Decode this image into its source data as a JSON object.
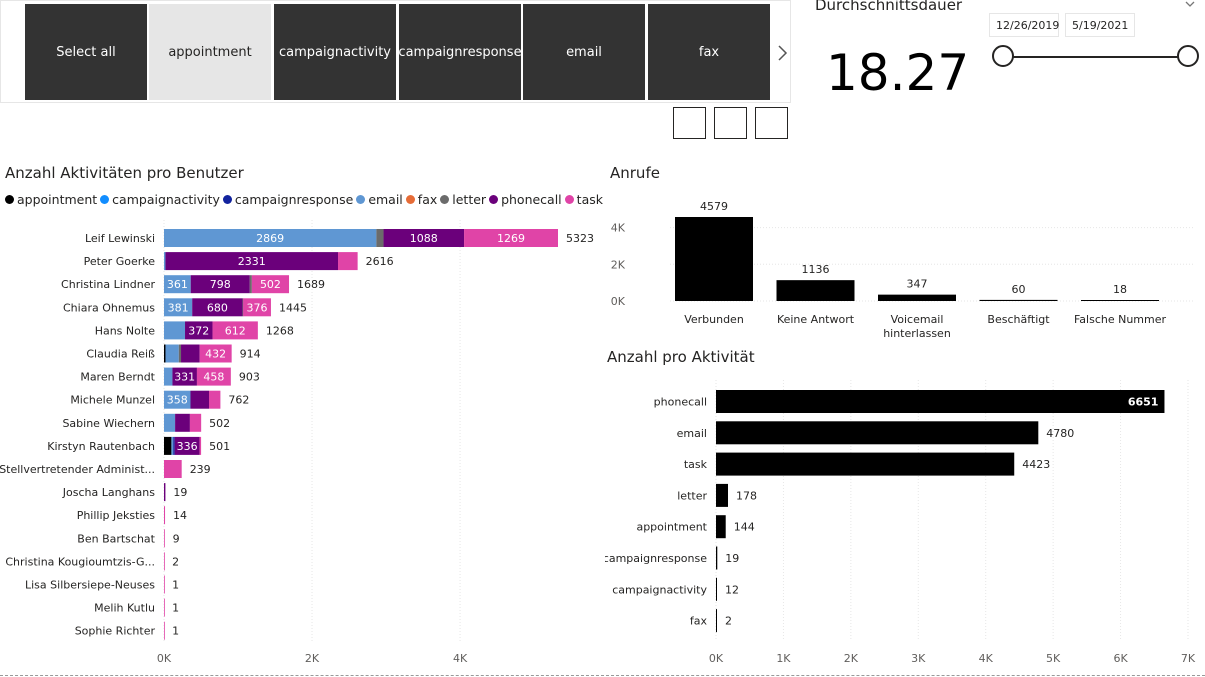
{
  "slicer": {
    "tiles": [
      {
        "label": "Select all",
        "selected": false
      },
      {
        "label": "appointment",
        "selected": true
      },
      {
        "label": "campaignactivity",
        "selected": false
      },
      {
        "label": "campaignresponse",
        "selected": false
      },
      {
        "label": "email",
        "selected": false
      },
      {
        "label": "fax",
        "selected": false
      }
    ],
    "next_icon": "chevron-right-icon"
  },
  "card": {
    "title": "Durchschnittsdauer",
    "value": "18.27"
  },
  "date_slicer": {
    "start": "12/26/2019",
    "end": "5/19/2021",
    "chevron_icon": "chevron-down-icon"
  },
  "colors": {
    "appointment": "#000000",
    "campaignactivity": "#118DFF",
    "campaignresponse": "#12239E",
    "email": "#5F97D3",
    "fax": "#E66C37",
    "letter": "#6B6B6B",
    "phonecall": "#6B007B",
    "task": "#E044A7",
    "bar": "#000000"
  },
  "chart_data": [
    {
      "type": "bar",
      "orientation": "horizontal",
      "stacked": true,
      "title": "Anzahl Aktivitäten pro Benutzer",
      "legend_position": "top-left",
      "series_names": [
        "appointment",
        "campaignactivity",
        "campaignresponse",
        "email",
        "fax",
        "letter",
        "phonecall",
        "task"
      ],
      "xlim": [
        0,
        5323
      ],
      "xticks": [
        "0K",
        "2K",
        "4K"
      ],
      "rows": [
        {
          "name": "Leif Lewinski",
          "total": 5323,
          "segments": [
            {
              "s": "email",
              "v": 2869,
              "label": "2869"
            },
            {
              "s": "letter",
              "v": 97
            },
            {
              "s": "phonecall",
              "v": 1088,
              "label": "1088"
            },
            {
              "s": "task",
              "v": 1269,
              "label": "1269"
            }
          ]
        },
        {
          "name": "Peter Goerke",
          "total": 2616,
          "segments": [
            {
              "s": "email",
              "v": 20
            },
            {
              "s": "phonecall",
              "v": 2331,
              "label": "2331"
            },
            {
              "s": "task",
              "v": 265
            }
          ]
        },
        {
          "name": "Christina Lindner",
          "total": 1689,
          "segments": [
            {
              "s": "email",
              "v": 361,
              "label": "361"
            },
            {
              "s": "phonecall",
              "v": 798,
              "label": "798"
            },
            {
              "s": "letter",
              "v": 28
            },
            {
              "s": "task",
              "v": 502,
              "label": "502"
            }
          ]
        },
        {
          "name": "Chiara Ohnemus",
          "total": 1445,
          "segments": [
            {
              "s": "email",
              "v": 381,
              "label": "381"
            },
            {
              "s": "phonecall",
              "v": 680,
              "label": "680"
            },
            {
              "s": "letter",
              "v": 8
            },
            {
              "s": "task",
              "v": 376,
              "label": "376"
            }
          ]
        },
        {
          "name": "Hans Nolte",
          "total": 1268,
          "segments": [
            {
              "s": "email",
              "v": 284
            },
            {
              "s": "phonecall",
              "v": 372,
              "label": "372"
            },
            {
              "s": "task",
              "v": 612,
              "label": "612"
            }
          ]
        },
        {
          "name": "Claudia Reiß",
          "total": 914,
          "segments": [
            {
              "s": "appointment",
              "v": 20
            },
            {
              "s": "email",
              "v": 180
            },
            {
              "s": "letter",
              "v": 30
            },
            {
              "s": "phonecall",
              "v": 252
            },
            {
              "s": "task",
              "v": 432,
              "label": "432"
            }
          ]
        },
        {
          "name": "Maren Berndt",
          "total": 903,
          "segments": [
            {
              "s": "email",
              "v": 114
            },
            {
              "s": "phonecall",
              "v": 331,
              "label": "331"
            },
            {
              "s": "task",
              "v": 458,
              "label": "458"
            }
          ]
        },
        {
          "name": "Michele Munzel",
          "total": 762,
          "segments": [
            {
              "s": "email",
              "v": 358,
              "label": "358"
            },
            {
              "s": "phonecall",
              "v": 250
            },
            {
              "s": "task",
              "v": 154
            }
          ]
        },
        {
          "name": "Sabine Wiechern",
          "total": 502,
          "segments": [
            {
              "s": "email",
              "v": 150
            },
            {
              "s": "phonecall",
              "v": 200
            },
            {
              "s": "task",
              "v": 152
            }
          ]
        },
        {
          "name": "Kirstyn Rautenbach",
          "total": 501,
          "segments": [
            {
              "s": "appointment",
              "v": 100
            },
            {
              "s": "email",
              "v": 25
            },
            {
              "s": "campaignresponse",
              "v": 20
            },
            {
              "s": "phonecall",
              "v": 336,
              "label": "336"
            },
            {
              "s": "task",
              "v": 20
            }
          ]
        },
        {
          "name": "Stellvertretender Administ...",
          "total": 239,
          "segments": [
            {
              "s": "task",
              "v": 239
            }
          ]
        },
        {
          "name": "Joscha Langhans",
          "total": 19,
          "segments": [
            {
              "s": "phonecall",
              "v": 19
            }
          ]
        },
        {
          "name": "Phillip Jeksties",
          "total": 14,
          "segments": [
            {
              "s": "task",
              "v": 14
            }
          ]
        },
        {
          "name": "Ben Bartschat",
          "total": 9,
          "segments": [
            {
              "s": "task",
              "v": 9
            }
          ]
        },
        {
          "name": "Christina Kougioumtzis-G...",
          "total": 2,
          "segments": [
            {
              "s": "task",
              "v": 2
            }
          ]
        },
        {
          "name": "Lisa Silbersiepe-Neuses",
          "total": 1,
          "segments": [
            {
              "s": "task",
              "v": 1
            }
          ]
        },
        {
          "name": "Melih Kutlu",
          "total": 1,
          "segments": [
            {
              "s": "task",
              "v": 1
            }
          ]
        },
        {
          "name": "Sophie Richter",
          "total": 1,
          "segments": [
            {
              "s": "task",
              "v": 1
            }
          ]
        }
      ]
    },
    {
      "type": "bar",
      "orientation": "vertical",
      "title": "Anrufe",
      "categories": [
        "Verbunden",
        "Keine Antwort",
        "Voicemail hinterlassen",
        "Beschäftigt",
        "Falsche Nummer"
      ],
      "values": [
        4579,
        1136,
        347,
        60,
        18
      ],
      "value_labels": [
        "4579",
        "1136",
        "347",
        "60",
        "18"
      ],
      "ylim": [
        0,
        4579
      ],
      "yticks": [
        "0K",
        "2K",
        "4K"
      ]
    },
    {
      "type": "bar",
      "orientation": "horizontal",
      "title": "Anzahl pro Aktivität",
      "categories": [
        "phonecall",
        "email",
        "task",
        "letter",
        "appointment",
        "campaignresponse",
        "campaignactivity",
        "fax"
      ],
      "values": [
        6651,
        4780,
        4423,
        178,
        144,
        19,
        12,
        2
      ],
      "value_labels": [
        "6651",
        "4780",
        "4423",
        "178",
        "144",
        "19",
        "12",
        "2"
      ],
      "xlim": [
        0,
        7000
      ],
      "xticks": [
        "0K",
        "1K",
        "2K",
        "3K",
        "4K",
        "5K",
        "6K",
        "7K"
      ]
    }
  ]
}
